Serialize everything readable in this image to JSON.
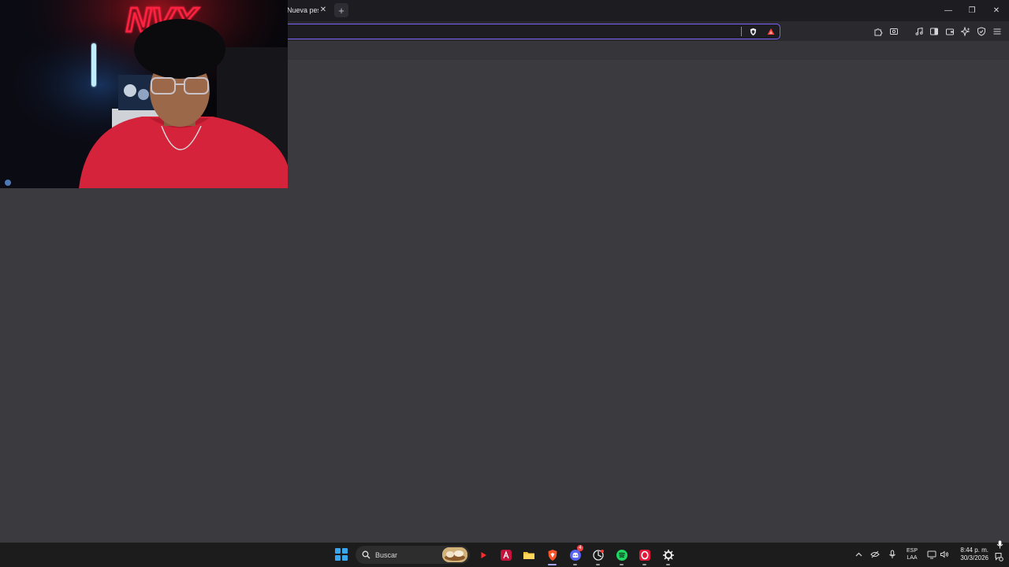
{
  "browser": {
    "tab": {
      "title": "Nueva pestaña",
      "close_glyph": "✕"
    },
    "new_tab_glyph": "+",
    "window_controls": {
      "minimize_glyph": "—",
      "maximize_glyph": "❐",
      "close_glyph": "✕"
    },
    "address_bar": {
      "value": "",
      "placeholder": ""
    },
    "toolbar_icons": [
      "extensions-icon",
      "screenshot-icon",
      "media-icon",
      "sidebar-icon",
      "wallet-icon",
      "leo-ai-icon",
      "vpn-icon",
      "menu-icon"
    ],
    "accent_color": "#7b61ff",
    "shield_color": "#f1f1f1",
    "rewards_color": "#ff3b3b"
  },
  "webcam": {
    "neon_sign": "NVX",
    "neon_color": "#ff2240",
    "shirt_color": "#d4233a"
  },
  "taskbar": {
    "search_label": "Buscar",
    "apps": [
      "youtube-music-icon",
      "affinity-icon",
      "file-explorer-icon",
      "brave-icon",
      "discord-icon",
      "chatgpt-icon",
      "spotify-icon",
      "opera-gx-icon",
      "steelseries-icon"
    ],
    "discord_badge": "4",
    "tray": {
      "language_line1": "ESP",
      "language_line2": "LAA",
      "time": "8:44 p. m.",
      "date": "30/3/2026"
    }
  }
}
